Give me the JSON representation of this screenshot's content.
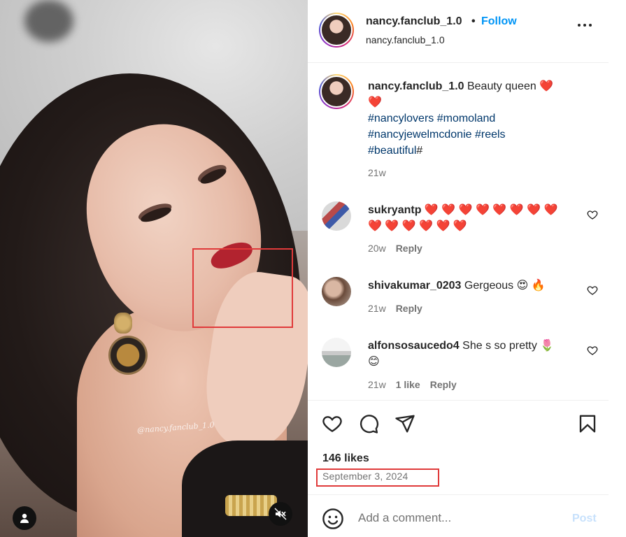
{
  "media": {
    "watermark": "@nancy.fanclub_1.0",
    "user_button_icon": "user-icon",
    "mute_button_icon": "speaker-muted-icon"
  },
  "header": {
    "username": "nancy.fanclub_1.0",
    "separator": "•",
    "follow_label": "Follow",
    "subtitle": "nancy.fanclub_1.0",
    "more_icon": "more-horizontal-icon"
  },
  "caption": {
    "username": "nancy.fanclub_1.0",
    "text": "Beauty queen",
    "emoji_line1": "❤️",
    "emoji_line2": "❤️",
    "hashtags_line1": "#nancylovers #momoland",
    "hashtags_line2": "#nancyjewelmcdonie #reels",
    "hashtags_line3": "#beautiful",
    "hashtags_line3_tail": "#",
    "time": "21w"
  },
  "comments": [
    {
      "username": "sukryantp",
      "text_line1": "❤️ ❤️ ❤️ ❤️ ❤️ ❤️ ❤️ ❤️",
      "text_line2": "❤️ ❤️ ❤️ ❤️ ❤️ ❤️",
      "time": "20w",
      "likes": "",
      "reply": "Reply"
    },
    {
      "username": "shivakumar_0203",
      "text_line1": "Gergeous 😍 🔥",
      "text_line2": "",
      "time": "21w",
      "likes": "",
      "reply": "Reply"
    },
    {
      "username": "alfonsosaucedo4",
      "text_line1": "She s so pretty 🌷",
      "text_line2": "😊",
      "time": "21w",
      "likes": "1 like",
      "reply": "Reply"
    }
  ],
  "actions": {
    "like_icon": "heart-icon",
    "comment_icon": "comment-bubble-icon",
    "share_icon": "paper-plane-icon",
    "save_icon": "bookmark-icon",
    "likes_count": "146 likes",
    "date": "September 3, 2024"
  },
  "composer": {
    "emoji_icon": "smiley-icon",
    "placeholder": "Add a comment...",
    "post_label": "Post"
  },
  "colors": {
    "link_blue": "#0095f6",
    "hashtag_blue": "#00376b",
    "annotation_red": "#e03a3a",
    "heart_red": "#e0245e"
  }
}
